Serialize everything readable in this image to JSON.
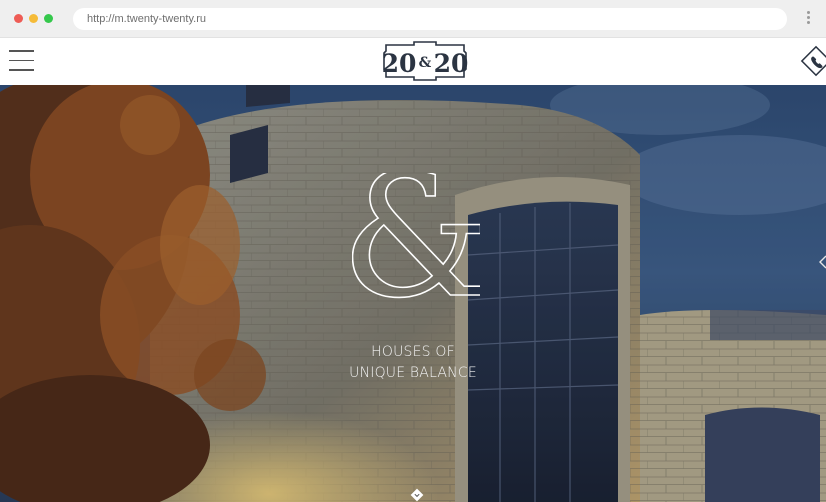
{
  "browser": {
    "url": "http://m.twenty-twenty.ru",
    "dot_colors": [
      "#ee5c55",
      "#f5bb38",
      "#35c84c"
    ]
  },
  "header": {
    "menu_icon": "hamburger-icon",
    "logo_text": "20&20",
    "phone_icon": "phone-icon"
  },
  "hero": {
    "symbol": "&",
    "tagline_line1": "HOUSES OF",
    "tagline_line2": "UNIQUE BALANCE",
    "scroll_icon": "chevron-down-icon",
    "side_icon": "chevron-left-icon"
  },
  "colors": {
    "accent": "#2b3442",
    "tagline": "#f3f3f3"
  }
}
